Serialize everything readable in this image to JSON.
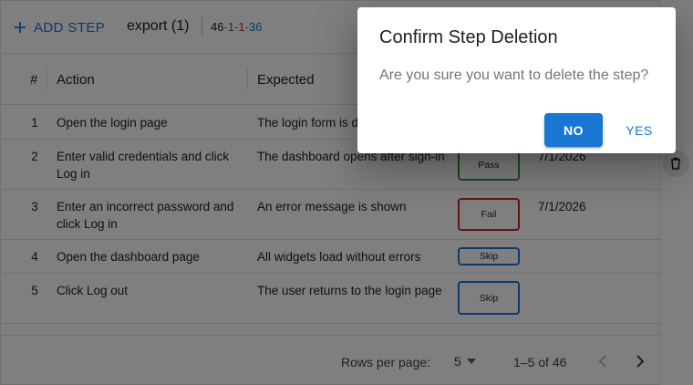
{
  "toolbar": {
    "add_step_label": "ADD STEP",
    "export_label": "export (1)",
    "counts": {
      "total": "46",
      "pass": "1",
      "fail": "1",
      "skip": "36",
      "dash": "-"
    }
  },
  "table": {
    "columns": {
      "num": "#",
      "action": "Action",
      "expected": "Expected"
    },
    "rows": [
      {
        "num": "1",
        "action": "Open the login page",
        "expected": "The login form is d",
        "status": "",
        "date": ""
      },
      {
        "num": "2",
        "action": "Enter valid credentials and click Log in",
        "expected": "The dashboard opens after sign-in",
        "status": "Pass",
        "date": "7/1/2026"
      },
      {
        "num": "3",
        "action": "Enter an incorrect password and click Log in",
        "expected": "An error message is shown",
        "status": "Fail",
        "date": "7/1/2026"
      },
      {
        "num": "4",
        "action": "Open the dashboard page",
        "expected": "All widgets load without errors",
        "status": "Skip",
        "date": ""
      },
      {
        "num": "5",
        "action": "Click Log out",
        "expected": "The user returns to the login page",
        "status": "Skip",
        "date": ""
      }
    ]
  },
  "footer": {
    "rows_per_page_label": "Rows per page:",
    "rows_per_page_value": "5",
    "range": "1–5 of 46"
  },
  "dialog": {
    "title": "Confirm Step Deletion",
    "message": "Are you sure you want to delete the step?",
    "no_label": "NO",
    "yes_label": "YES"
  },
  "colors": {
    "primary": "#1976d2",
    "pass": "#2e7d32",
    "fail": "#c62828",
    "skip": "#1976d2"
  },
  "icons": [
    "plus-icon",
    "delete-icon",
    "chevron-down-icon",
    "chevron-left-icon",
    "chevron-right-icon"
  ]
}
